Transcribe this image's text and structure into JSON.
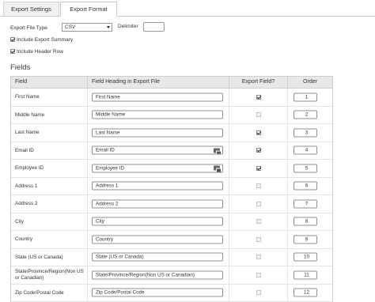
{
  "tabs": [
    {
      "label": "Export Settings",
      "active": false
    },
    {
      "label": "Export Format",
      "active": true
    }
  ],
  "options": {
    "file_type_label": "Export File Type",
    "file_type_value": "CSV",
    "delimiter_label": "Delimiter",
    "delimiter_value": "",
    "include_summary_label": "Include Export Summary",
    "include_summary_checked": true,
    "include_header_label": "Include Header Row",
    "include_header_checked": true
  },
  "fields_title": "Fields",
  "table": {
    "headers": [
      "Field",
      "Field Heading in Export File",
      "Export Field?",
      "Order"
    ],
    "rows": [
      {
        "field": "First Name",
        "heading": "First Name",
        "export": true,
        "order": "1",
        "icon": false
      },
      {
        "field": "Middle Name",
        "heading": "Middle Name",
        "export": false,
        "order": "2",
        "icon": false
      },
      {
        "field": "Last Name",
        "heading": "Last Name",
        "export": true,
        "order": "3",
        "icon": false
      },
      {
        "field": "Email ID",
        "heading": "Email ID",
        "export": true,
        "order": "4",
        "icon": true
      },
      {
        "field": "Employee ID",
        "heading": "Employee ID",
        "export": true,
        "order": "5",
        "icon": true
      },
      {
        "field": "Address 1",
        "heading": "Address 1",
        "export": false,
        "order": "6",
        "icon": false
      },
      {
        "field": "Address 2",
        "heading": "Address 2",
        "export": false,
        "order": "7",
        "icon": false
      },
      {
        "field": "City",
        "heading": "City",
        "export": false,
        "order": "8",
        "icon": false
      },
      {
        "field": "Country",
        "heading": "Country",
        "export": false,
        "order": "9",
        "icon": false
      },
      {
        "field": "State (US or Canada)",
        "heading": "State (US or Canada)",
        "export": false,
        "order": "10",
        "icon": false
      },
      {
        "field": "State/Province/Region(Non US or Canadian)",
        "heading": "State/Province/Region(Non US or Canadian)",
        "export": false,
        "order": "11",
        "icon": false
      },
      {
        "field": "Zip Code/Postal Code",
        "heading": "Zip Code/Postal Code",
        "export": false,
        "order": "12",
        "icon": false
      }
    ]
  }
}
